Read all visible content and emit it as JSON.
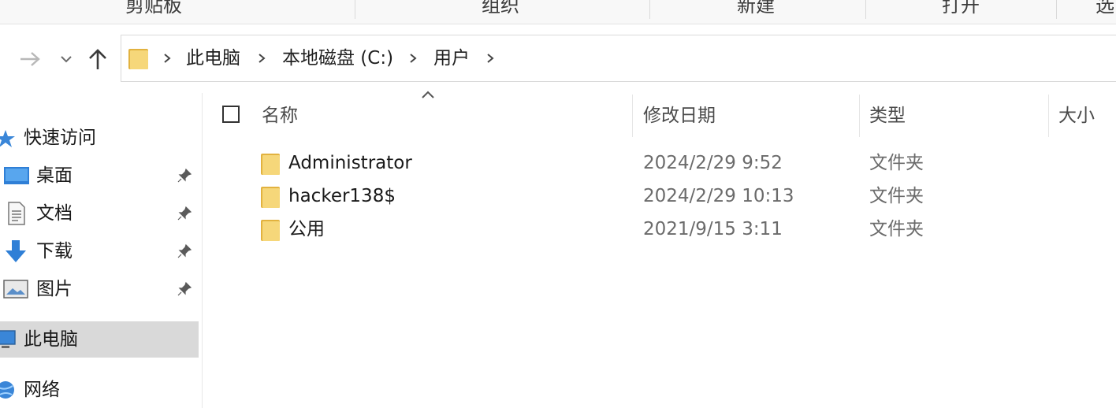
{
  "ribbon": {
    "groups": [
      "剪贴板",
      "组织",
      "新建",
      "打开",
      "选"
    ]
  },
  "navigation": {
    "forward_icon": "arrow-right-icon",
    "recent_icon": "chevron-down-icon",
    "up_icon": "arrow-up-icon"
  },
  "address_bar": {
    "breadcrumbs": [
      "此电脑",
      "本地磁盘 (C:)",
      "用户"
    ]
  },
  "sidebar": {
    "quick_access": "快速访问",
    "pinned": [
      {
        "label": "桌面",
        "icon": "desktop-icon"
      },
      {
        "label": "文档",
        "icon": "document-icon"
      },
      {
        "label": "下载",
        "icon": "download-icon"
      },
      {
        "label": "图片",
        "icon": "picture-icon"
      }
    ],
    "this_pc": "此电脑",
    "network": "网络"
  },
  "columns": {
    "name": "名称",
    "modified": "修改日期",
    "type": "类型",
    "size": "大小",
    "sorted_by": "name"
  },
  "files": [
    {
      "name": "Administrator",
      "modified": "2024/2/29 9:52",
      "type": "文件夹"
    },
    {
      "name": "hacker138$",
      "modified": "2024/2/29 10:13",
      "type": "文件夹"
    },
    {
      "name": "公用",
      "modified": "2021/9/15 3:11",
      "type": "文件夹"
    }
  ],
  "colors": {
    "folder": "#f4cf6a",
    "folder_dark": "#e2b23f",
    "selection": "#d9d9d9",
    "accent_blue": "#2f7fd6"
  }
}
